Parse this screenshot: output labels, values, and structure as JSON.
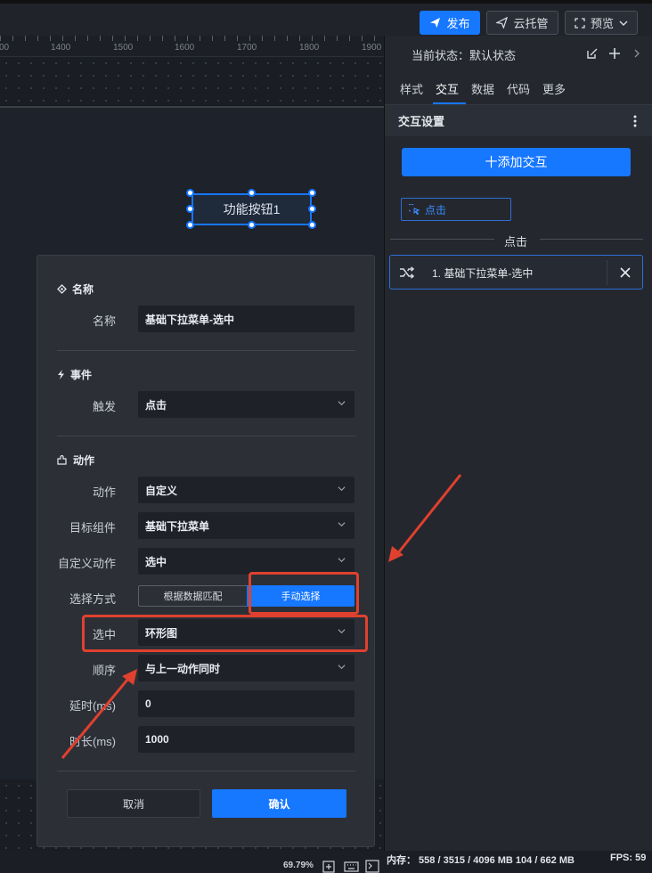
{
  "toolbar": {
    "publish_label": "发布",
    "cloud_label": "云托管",
    "preview_label": "预览"
  },
  "ruler": {
    "ticks": [
      "00",
      "1400",
      "1500",
      "1600",
      "1700",
      "1800",
      "1900"
    ]
  },
  "canvas": {
    "button_label": "功能按钮1"
  },
  "right_panel": {
    "status_label": "当前状态：",
    "status_value": "默认状态",
    "tabs": [
      "样式",
      "交互",
      "数据",
      "代码",
      "更多"
    ],
    "active_tab": "交互",
    "section_title": "交互设置",
    "add_button": "十添加交互",
    "trigger_tag": "点击",
    "divider_label": "点击",
    "action_item": "1. 基础下拉菜单-选中"
  },
  "dialog": {
    "name_section": "名称",
    "name_label": "名称",
    "name_value": "基础下拉菜单-选中",
    "event_section": "事件",
    "trigger_label": "触发",
    "trigger_value": "点击",
    "action_section": "动作",
    "action_label": "动作",
    "action_value": "自定义",
    "target_label": "目标组件",
    "target_value": "基础下拉菜单",
    "custom_action_label": "自定义动作",
    "custom_action_value": "选中",
    "select_mode_label": "选择方式",
    "select_mode_options": [
      "根据数据匹配",
      "手动选择"
    ],
    "select_mode_selected": "手动选择",
    "selected_label": "选中",
    "selected_value": "环形图",
    "order_label": "顺序",
    "order_value": "与上一动作同时",
    "delay_label": "延时(ms)",
    "delay_value": "0",
    "duration_label": "时长(ms)",
    "duration_value": "1000",
    "cancel_label": "取消",
    "confirm_label": "确认"
  },
  "statusbar": {
    "zoom": "69.79%",
    "memory": "内存： 558 / 3515 / 4096 MB  104 / 662 MB",
    "fps": "FPS: 59"
  },
  "colors": {
    "accent": "#1677ff",
    "annotation": "#e0412e",
    "panel_bg": "#24272e",
    "dialog_bg": "#2c2f36"
  }
}
